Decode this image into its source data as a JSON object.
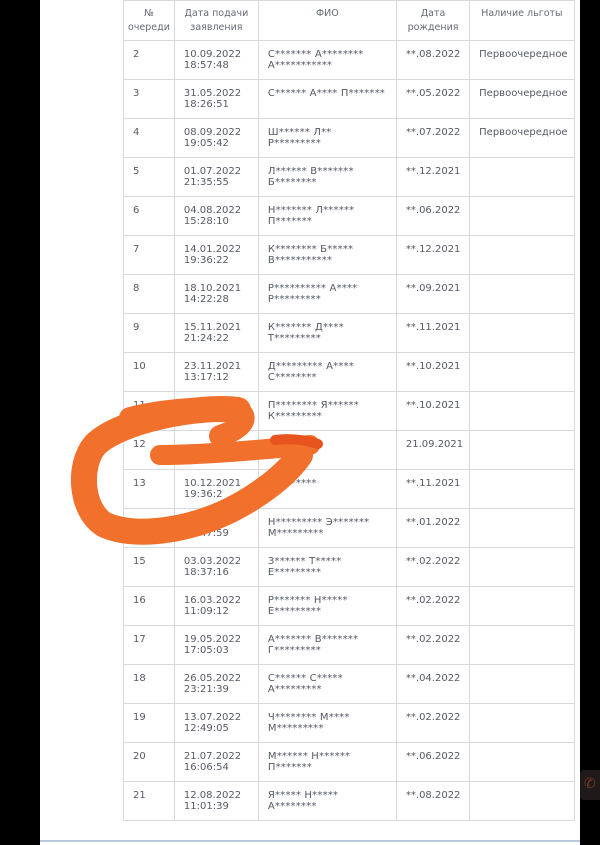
{
  "table": {
    "headers": {
      "num": "№ очереди",
      "date": "Дата подачи заявления",
      "name": "ФИО",
      "birth": "Дата рождения",
      "benefit": "Наличие льготы"
    },
    "rows": [
      {
        "num": "2",
        "date": "10.09.2022",
        "time": "18:57:48",
        "name1": "С******* А********",
        "name2": "А***********",
        "birth": "**.08.2022",
        "benefit": "Первоочередное"
      },
      {
        "num": "3",
        "date": "31.05.2022",
        "time": "18:26:51",
        "name1": "С****** А**** П*******",
        "name2": "",
        "birth": "**.05.2022",
        "benefit": "Первоочередное"
      },
      {
        "num": "4",
        "date": "08.09.2022",
        "time": "19:05:42",
        "name1": "Ш****** Л**",
        "name2": "Р*********",
        "birth": "**.07.2022",
        "benefit": "Первоочередное"
      },
      {
        "num": "5",
        "date": "01.07.2022",
        "time": "21:35:55",
        "name1": "Л****** В*******",
        "name2": "Б********",
        "birth": "**.12.2021",
        "benefit": ""
      },
      {
        "num": "6",
        "date": "04.08.2022",
        "time": "15:28:10",
        "name1": "Н******* Л******",
        "name2": "П*******",
        "birth": "**.06.2022",
        "benefit": ""
      },
      {
        "num": "7",
        "date": "14.01.2022",
        "time": "19:36:22",
        "name1": "К******** Б*****",
        "name2": "В***********",
        "birth": "**.12.2021",
        "benefit": ""
      },
      {
        "num": "8",
        "date": "18.10.2021",
        "time": "14:22:28",
        "name1": "Р********** А****",
        "name2": "Р*********",
        "birth": "**.09.2021",
        "benefit": ""
      },
      {
        "num": "9",
        "date": "15.11.2021",
        "time": "21:24:22",
        "name1": "К******* Д****",
        "name2": "Т*********",
        "birth": "**.11.2021",
        "benefit": ""
      },
      {
        "num": "10",
        "date": "23.11.2021",
        "time": "13:17:12",
        "name1": "Д********* А****",
        "name2": "С********",
        "birth": "**.10.2021",
        "benefit": ""
      },
      {
        "num": "11",
        "date": "",
        "time": "",
        "name1": "П******** Я******",
        "name2": "К*********",
        "birth": "**.10.2021",
        "benefit": ""
      },
      {
        "num": "12",
        "date": "",
        "time": "",
        "name1": "",
        "name2": "",
        "birth": "21.09.2021",
        "benefit": ""
      },
      {
        "num": "13",
        "date": "10.12.2021",
        "time": "19:36:2",
        "name1": "В********",
        "name2": "",
        "birth": "**.11.2021",
        "benefit": ""
      },
      {
        "num": "",
        "date": "",
        "time": "06:47:59",
        "name1": "Н********* Э*******",
        "name2": "М*********",
        "birth": "**.01.2022",
        "benefit": ""
      },
      {
        "num": "15",
        "date": "03.03.2022",
        "time": "18:37:16",
        "name1": "З****** Т*****",
        "name2": "Е*********",
        "birth": "**.02.2022",
        "benefit": ""
      },
      {
        "num": "16",
        "date": "16.03.2022",
        "time": "11:09:12",
        "name1": "Р******* Н*****",
        "name2": "Е*********",
        "birth": "**.02.2022",
        "benefit": ""
      },
      {
        "num": "17",
        "date": "19.05.2022",
        "time": "17:05:03",
        "name1": "А******* В*******",
        "name2": "Г*********",
        "birth": "**.02.2022",
        "benefit": ""
      },
      {
        "num": "18",
        "date": "26.05.2022",
        "time": "23:21:39",
        "name1": "С****** С*****",
        "name2": "А*********",
        "birth": "**.04.2022",
        "benefit": ""
      },
      {
        "num": "19",
        "date": "13.07.2022",
        "time": "12:49:05",
        "name1": "Ч******** М****",
        "name2": "М*********",
        "birth": "**.02.2022",
        "benefit": ""
      },
      {
        "num": "20",
        "date": "21.07.2022",
        "time": "16:06:54",
        "name1": "М****** Н******",
        "name2": "П*******",
        "birth": "**.06.2022",
        "benefit": ""
      },
      {
        "num": "21",
        "date": "12.08.2022",
        "time": "11:01:39",
        "name1": "Я***** Н*****",
        "name2": "А********",
        "birth": "**.08.2022",
        "benefit": ""
      }
    ]
  },
  "colors": {
    "scribble": "#f0702c",
    "scribble_dark": "#e8541e",
    "grid": "#d6d9de",
    "text": "#555a66"
  },
  "icons": {
    "corner_badge": "chat-icon"
  }
}
